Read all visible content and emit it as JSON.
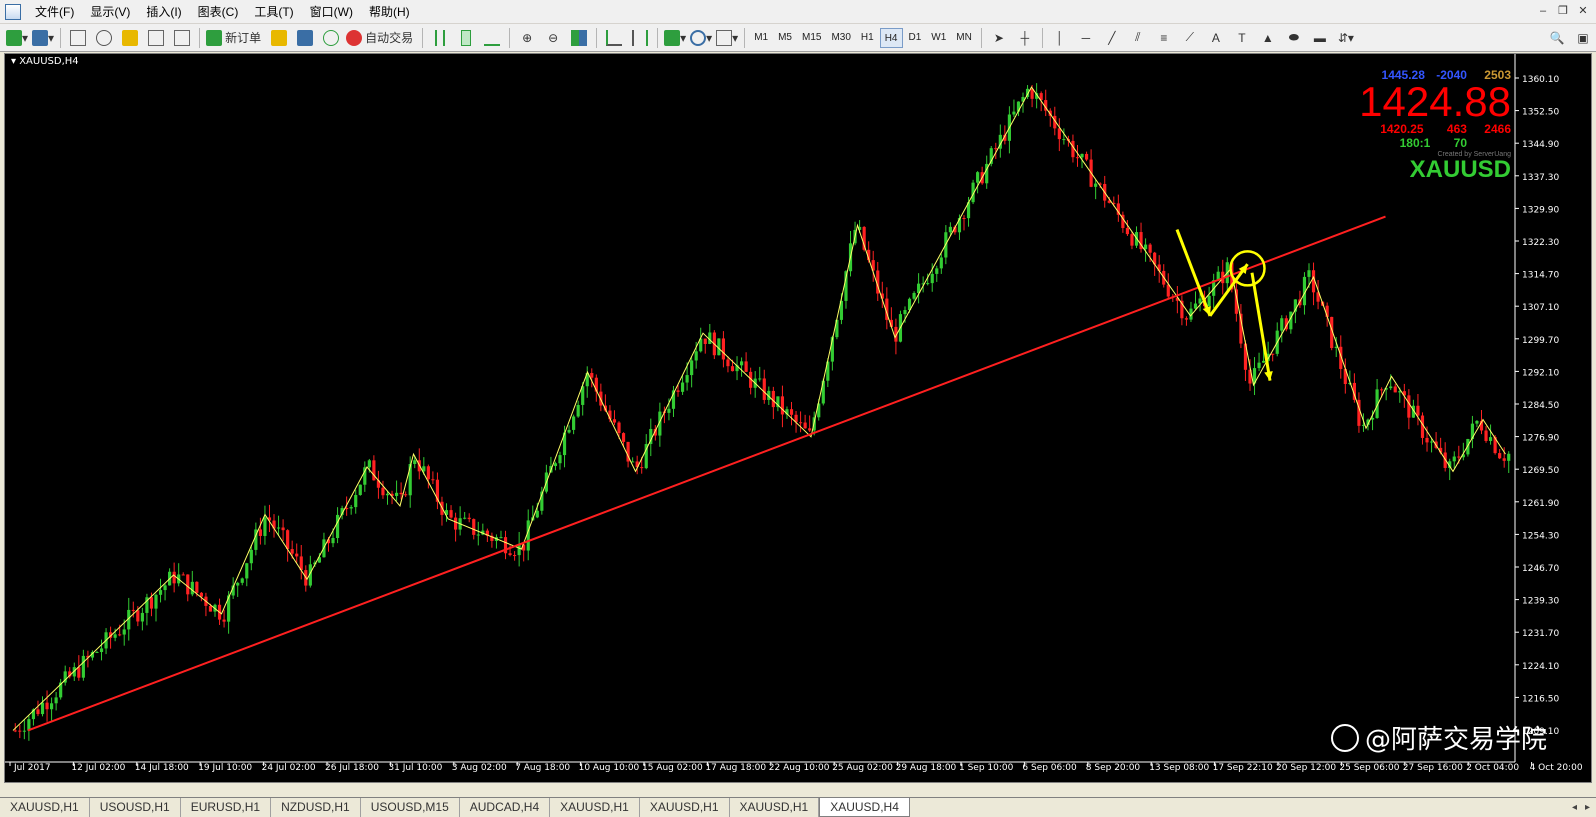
{
  "menu": {
    "items": [
      "文件(F)",
      "显示(V)",
      "插入(I)",
      "图表(C)",
      "工具(T)",
      "窗口(W)",
      "帮助(H)"
    ]
  },
  "toolbar": {
    "new_order_label": "新订单",
    "auto_trade_label": "自动交易",
    "timeframes": [
      "M1",
      "M5",
      "M15",
      "M30",
      "H1",
      "H4",
      "D1",
      "W1",
      "MN"
    ],
    "active_timeframe": "H4"
  },
  "chart": {
    "title": "XAUUSD,H4",
    "price_labels": [
      "1360.10",
      "1352.50",
      "1344.90",
      "1337.30",
      "1329.90",
      "1322.30",
      "1314.70",
      "1307.10",
      "1299.70",
      "1292.10",
      "1284.50",
      "1276.90",
      "1269.50",
      "1261.90",
      "1254.30",
      "1246.70",
      "1239.30",
      "1231.70",
      "1224.10",
      "1216.50",
      "1209.10"
    ],
    "time_labels": [
      "Jul 2017",
      "12 Jul 02:00",
      "14 Jul 18:00",
      "19 Jul 10:00",
      "24 Jul 02:00",
      "26 Jul 18:00",
      "31 Jul 10:00",
      "3 Aug 02:00",
      "7 Aug 18:00",
      "10 Aug 10:00",
      "15 Aug 02:00",
      "17 Aug 18:00",
      "22 Aug 10:00",
      "25 Aug 02:00",
      "29 Aug 18:00",
      "1 Sep 10:00",
      "6 Sep 06:00",
      "8 Sep 20:00",
      "13 Sep 08:00",
      "17 Sep 22:10",
      "20 Sep 12:00",
      "25 Sep 06:00",
      "27 Sep 16:00",
      "2 Oct 04:00",
      "4 Oct 20:00"
    ]
  },
  "info_panel": {
    "price_top": "1445.28",
    "change_top": "-2040",
    "count_top": "2503",
    "current_price": "1424.88",
    "low_price": "1420.25",
    "mid_value": "463",
    "right_value": "2466",
    "ratio": "180:1",
    "ratio_value": "70",
    "credit": "Created by ServerUang",
    "symbol": "XAUUSD",
    "colors": {
      "price_top": "#3355ff",
      "change_top": "#3355ff",
      "count_top": "#cc9933"
    }
  },
  "tabs": [
    "XAUUSD,H1",
    "USOUSD,H1",
    "EURUSD,H1",
    "NZDUSD,H1",
    "USOUSD,M15",
    "AUDCAD,H4",
    "XAUUSD,H1",
    "XAUUSD,H1",
    "XAUUSD,H1",
    "XAUUSD,H4"
  ],
  "active_tab_index": 9,
  "watermark": "@阿萨交易学院",
  "colors": {
    "background": "#000000",
    "bull": "#33cc33",
    "bear": "#ff2222",
    "zigzag": "#ffff66",
    "trendline": "#ff2020",
    "arrow": "#ffff00"
  }
}
